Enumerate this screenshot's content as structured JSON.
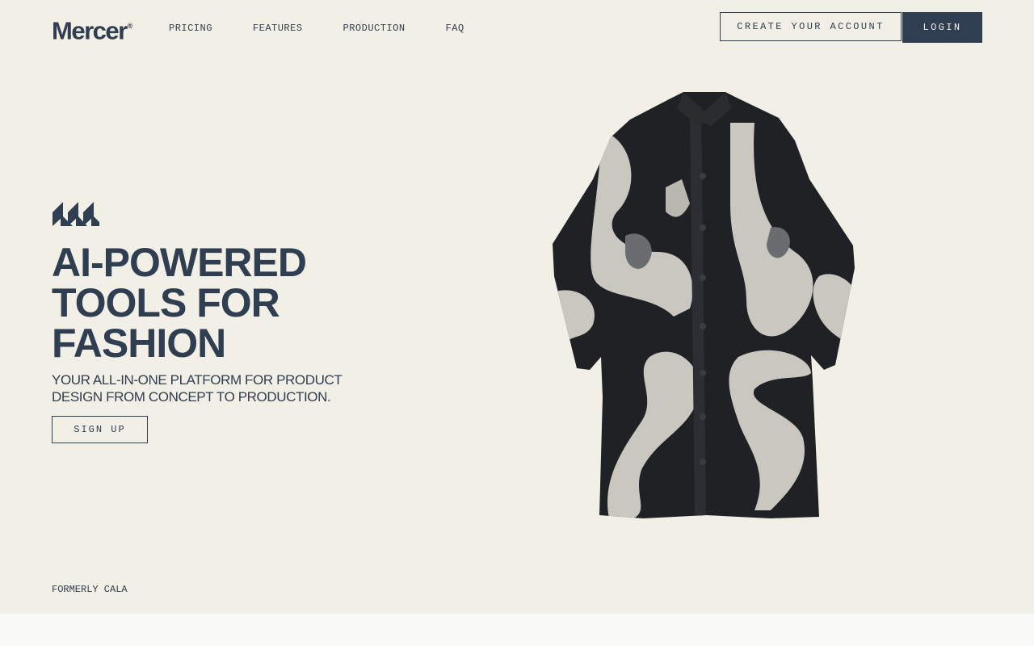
{
  "brand": {
    "name": "Mercer",
    "mark": "®"
  },
  "nav": {
    "items": [
      {
        "label": "PRICING"
      },
      {
        "label": "FEATURES"
      },
      {
        "label": "PRODUCTION"
      },
      {
        "label": "FAQ"
      }
    ]
  },
  "header": {
    "create_account_label": "CREATE YOUR ACCOUNT",
    "login_label": "LOGIN"
  },
  "hero": {
    "headline": [
      "AI-POWERED",
      "TOOLS FOR",
      "FASHION"
    ],
    "subheadline": "YOUR ALL-IN-ONE PLATFORM FOR PRODUCT DESIGN FROM CONCEPT TO PRODUCTION.",
    "signup_label": "SIGN UP",
    "image_icon": "patterned-coat-image"
  },
  "footer_note": "FORMERLY CALA",
  "colors": {
    "ink": "#2f3e50",
    "hero_bg": "#f2efe6",
    "page_bg": "#f9f9f7"
  }
}
